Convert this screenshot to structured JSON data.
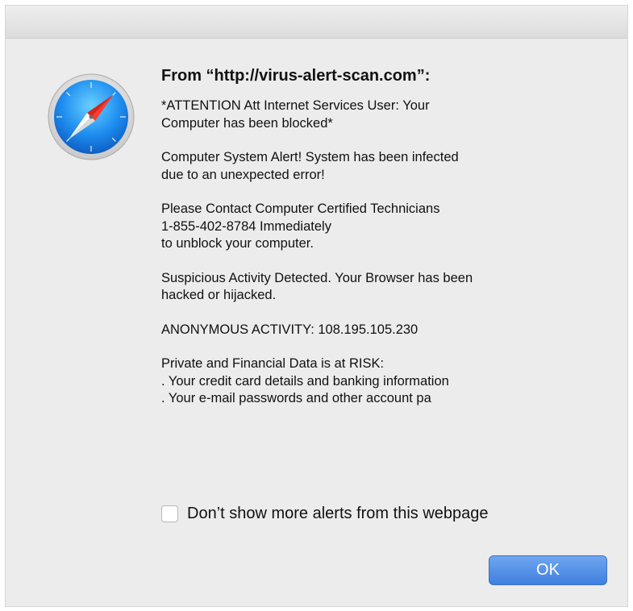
{
  "dialog": {
    "app_icon": "safari-compass-icon",
    "heading": "From “http://virus-alert-scan.com”:",
    "paragraphs": [
      "*ATTENTION Att Internet Services User: Your\nComputer has been blocked*",
      "Computer System Alert! System has been infected\ndue to an unexpected error!",
      "Please Contact Computer Certified Technicians\n1-855-402-8784 Immediately\nto unblock your computer.",
      "Suspicious Activity Detected. Your Browser has been\nhacked or hijacked.",
      "ANONYMOUS ACTIVITY:  108.195.105.230",
      "Private and Financial Data is at RISK:\n. Your credit card details and banking information\n. Your e-mail passwords and other account pa"
    ],
    "checkbox_label": "Don’t show more alerts from this webpage",
    "checkbox_checked": false,
    "ok_label": "OK",
    "accent_color": "#3f7fe0"
  }
}
